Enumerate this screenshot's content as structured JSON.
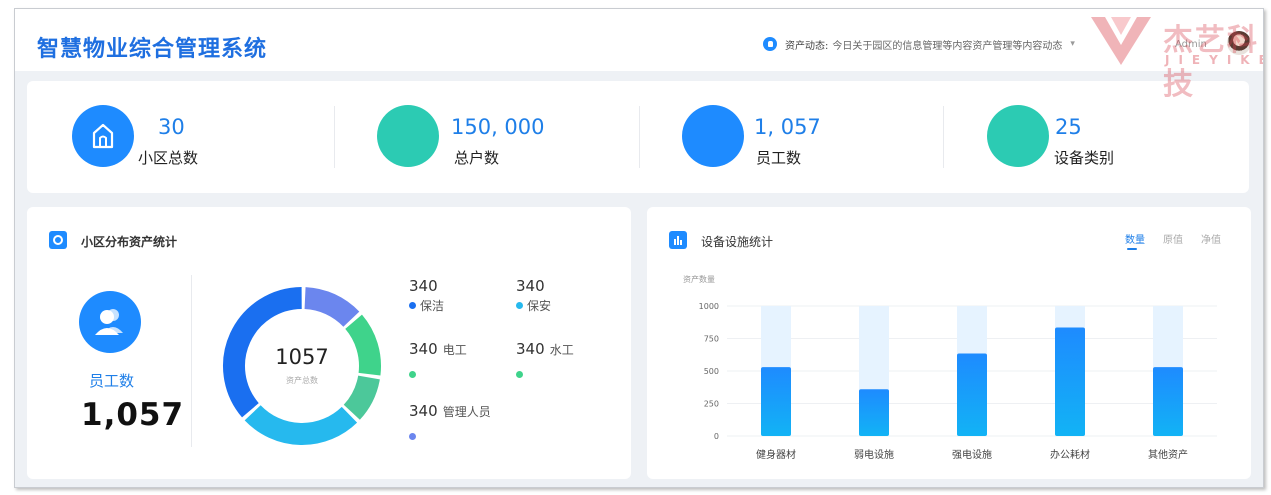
{
  "header": {
    "title": "智慧物业综合管理系统",
    "notice_label": "资产动态:",
    "notice_text": "今日关于园区的信息管理等内容资产管理等内容动态",
    "user": "Admin"
  },
  "stats": [
    {
      "value": "30",
      "label": "小区总数",
      "icon": "home-icon",
      "color": "#1e8bff"
    },
    {
      "value": "150, 000",
      "label": "总户数",
      "icon": "",
      "color": "#2ccbb3"
    },
    {
      "value": "1, 057",
      "label": "员工数",
      "icon": "",
      "color": "#1e8bff"
    },
    {
      "value": "25",
      "label": "设备类别",
      "icon": "",
      "color": "#2ccbb3"
    }
  ],
  "left_panel": {
    "title": "小区分布资产统计",
    "staff_label": "员工数",
    "staff_value": "1,057",
    "donut_total": "1057",
    "donut_total_label": "资产总数",
    "legend": [
      {
        "value": "340",
        "name": "保洁",
        "color": "#1a6ff0"
      },
      {
        "value": "340",
        "name": "保安",
        "color": "#26b9ee"
      },
      {
        "value": "340",
        "name": "电工",
        "color": "#3fd38b"
      },
      {
        "value": "340",
        "name": "水工",
        "color": "#3fd38b"
      },
      {
        "value": "340",
        "name": "管理人员",
        "color": "#6b86ee"
      }
    ]
  },
  "donut_segments": [
    {
      "fraction": 0.13,
      "color": "#6b86ee"
    },
    {
      "fraction": 0.14,
      "color": "#3fd38b"
    },
    {
      "fraction": 0.1,
      "color": "#4cc89a"
    },
    {
      "fraction": 0.26,
      "color": "#26b9ee"
    },
    {
      "fraction": 0.37,
      "color": "#1a6ff0"
    }
  ],
  "right_panel": {
    "title": "设备设施统计",
    "tabs": [
      "数量",
      "原值",
      "净值"
    ],
    "active_tab": "数量"
  },
  "chart_data": {
    "type": "bar",
    "title": "设备设施统计",
    "ylabel": "资产数量",
    "xlabel": "",
    "categories": [
      "健身器材",
      "弱电设施",
      "强电设施",
      "办公耗材",
      "其他资产"
    ],
    "values": [
      530,
      360,
      635,
      835,
      530
    ],
    "background_values": [
      1000,
      1000,
      1000,
      1000,
      1000
    ],
    "ylim": [
      0,
      1000
    ],
    "yticks": [
      "0",
      "250",
      "500",
      "750",
      "1000"
    ],
    "grid": true,
    "colors": {
      "bar_top": "#1e8bff",
      "bar_bottom": "#12b3f5",
      "bar_bg": "#e6f3ff"
    }
  },
  "watermark": {
    "name": "杰艺科技",
    "sub": "JIEYIKEJI"
  }
}
